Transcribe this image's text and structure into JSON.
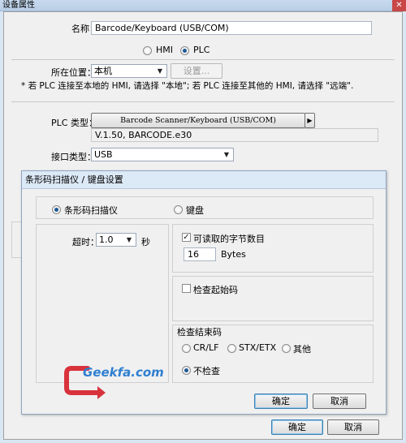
{
  "window": {
    "title": "设备属性",
    "close_glyph": "✕"
  },
  "general": {
    "name_label": "名称：",
    "name_value": "Barcode/Keyboard (USB/COM)",
    "device_types": [
      {
        "label": "HMI",
        "selected": false
      },
      {
        "label": "PLC",
        "selected": true
      }
    ],
    "location_label": "所在位置：",
    "location_value": "本机",
    "settings_button": "设置...",
    "note": "* 若 PLC 连接至本地的 HMI, 请选择 \"本地\"; 若 PLC 连接至其他的 HMI, 请选择 \"远端\"."
  },
  "plc": {
    "type_label": "PLC 类型：",
    "type_value": "Barcode Scanner/Keyboard (USB/COM)",
    "type_arrow": "▶",
    "version_info": "V.1.50, BARCODE.e30",
    "interface_label": "接口类型：",
    "interface_value": "USB"
  },
  "dialog": {
    "title": "条形码扫描仪 / 键盘设置",
    "modes": [
      {
        "label": "条形码扫描仪",
        "selected": true
      },
      {
        "label": "键盘",
        "selected": false
      }
    ],
    "timeout_label": "超时：",
    "timeout_value": "1.0",
    "timeout_unit": "秒",
    "readable_bytes_label": "可读取的字节数目",
    "readable_bytes_checked": true,
    "bytes_value": "16",
    "bytes_unit": "Bytes",
    "check_start_label": "检查起始码",
    "check_start_checked": false,
    "end_code_title": "检查结束码",
    "end_codes": [
      {
        "label": "CR/LF",
        "selected": false
      },
      {
        "label": "STX/ETX",
        "selected": false
      },
      {
        "label": "其他",
        "selected": false
      },
      {
        "label": "不检查",
        "selected": true
      }
    ],
    "ok_button": "确定",
    "cancel_button": "取消"
  },
  "watermark": {
    "text": "Geekfa.com"
  },
  "footer": {
    "ok_button": "确定",
    "cancel_button": "取消"
  },
  "colors": {
    "dialog_title_bg": "#dce9f6",
    "accent_blue": "#1e5a96",
    "watermark_red": "#d8323c",
    "watermark_blue": "#2f7fd1"
  }
}
